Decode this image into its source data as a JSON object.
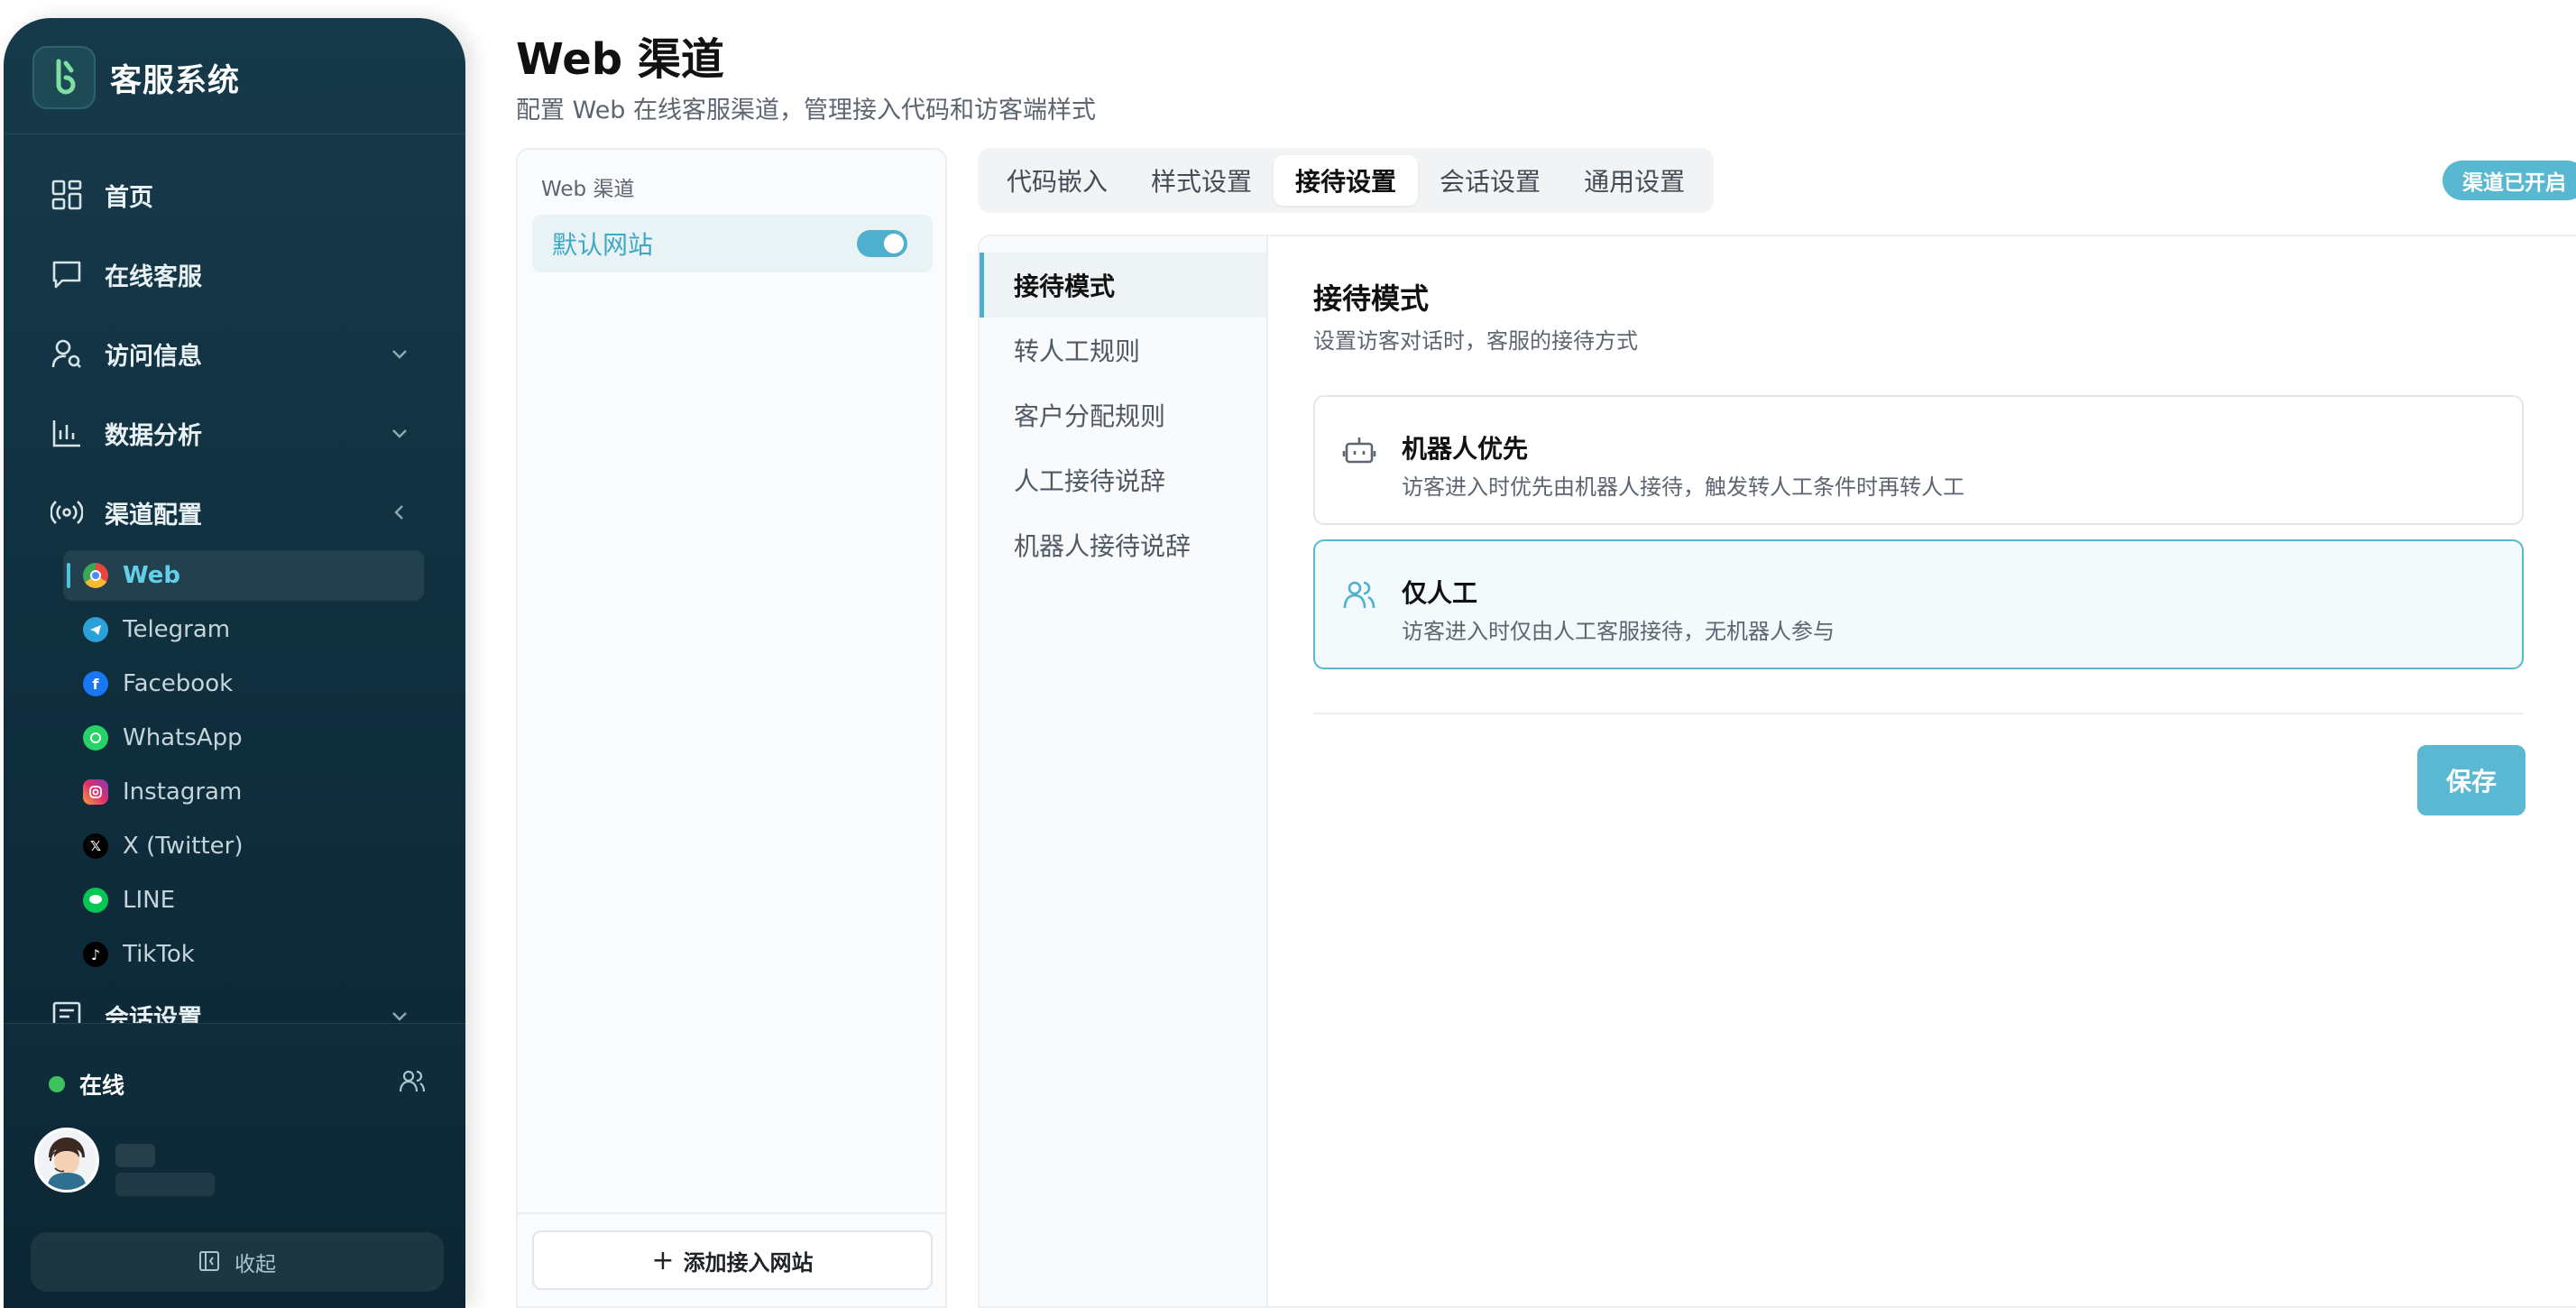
{
  "app": {
    "name": "客服系统"
  },
  "sidebar": {
    "nav": [
      {
        "label": "首页",
        "icon": "dashboard-icon"
      },
      {
        "label": "在线客服",
        "icon": "chat-icon"
      },
      {
        "label": "访问信息",
        "icon": "visitor-search-icon"
      },
      {
        "label": "数据分析",
        "icon": "bar-chart-icon"
      },
      {
        "label": "渠道配置",
        "icon": "broadcast-icon"
      },
      {
        "label": "会话设置",
        "icon": "document-icon"
      }
    ],
    "channels": [
      {
        "label": "Web",
        "icon": "chrome-icon",
        "active": true
      },
      {
        "label": "Telegram",
        "icon": "telegram-icon"
      },
      {
        "label": "Facebook",
        "icon": "facebook-icon"
      },
      {
        "label": "WhatsApp",
        "icon": "whatsapp-icon"
      },
      {
        "label": "Instagram",
        "icon": "instagram-icon"
      },
      {
        "label": "X (Twitter)",
        "icon": "x-twitter-icon"
      },
      {
        "label": "LINE",
        "icon": "line-icon"
      },
      {
        "label": "TikTok",
        "icon": "tiktok-icon"
      }
    ],
    "status": "在线",
    "collapse_label": "收起"
  },
  "header": {
    "title": "Web 渠道",
    "subtitle": "配置 Web 在线客服渠道，管理接入代码和访客端样式"
  },
  "site_list": {
    "heading": "Web 渠道",
    "sites": [
      {
        "label": "默认网站",
        "enabled": true
      }
    ],
    "add_label": "添加接入网站"
  },
  "tabs": [
    {
      "label": "代码嵌入"
    },
    {
      "label": "样式设置"
    },
    {
      "label": "接待设置",
      "active": true
    },
    {
      "label": "会话设置"
    },
    {
      "label": "通用设置"
    }
  ],
  "channel_badge": "渠道已开启",
  "settings_menu": [
    {
      "label": "接待模式",
      "active": true
    },
    {
      "label": "转人工规则"
    },
    {
      "label": "客户分配规则"
    },
    {
      "label": "人工接待说辞"
    },
    {
      "label": "机器人接待说辞"
    }
  ],
  "reception": {
    "title": "接待模式",
    "subtitle": "设置访客对话时，客服的接待方式",
    "options": [
      {
        "title": "机器人优先",
        "desc": "访客进入时优先由机器人接待，触发转人工条件时再转人工",
        "icon": "robot-icon",
        "selected": false
      },
      {
        "title": "仅人工",
        "desc": "访客进入时仅由人工客服接待，无机器人参与",
        "icon": "users-icon",
        "selected": true
      }
    ],
    "save_label": "保存"
  },
  "colors": {
    "accent": "#58b7d1",
    "sidebar_bg": "#12303f",
    "online": "#3ec25e"
  }
}
